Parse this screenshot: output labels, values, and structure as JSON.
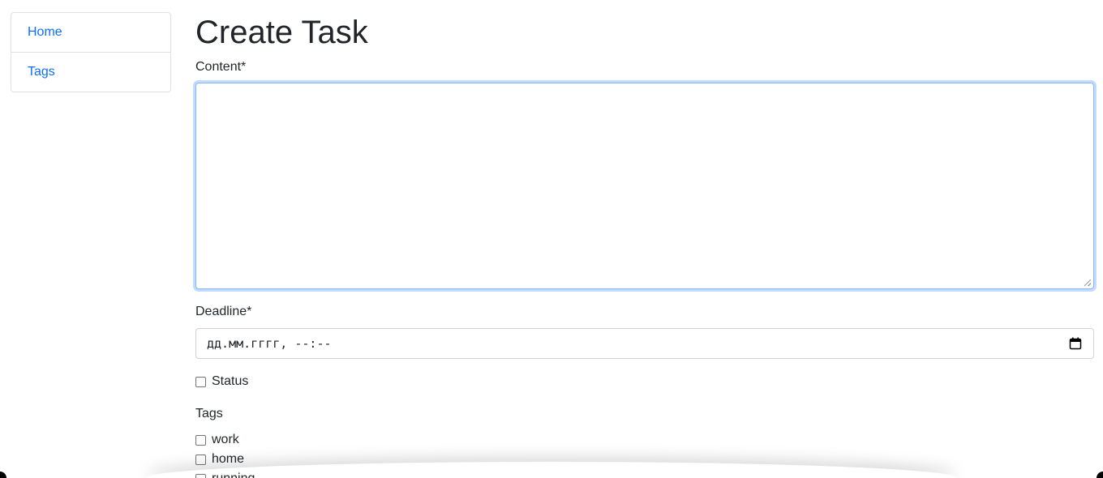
{
  "sidebar": {
    "items": [
      {
        "label": "Home"
      },
      {
        "label": "Tags"
      }
    ]
  },
  "main": {
    "title": "Create Task",
    "content_label": "Content*",
    "content_value": "",
    "deadline_label": "Deadline*",
    "deadline_placeholder": "дд.мм.гггг, --:--",
    "status_label": "Status",
    "tags_label": "Tags",
    "tags": [
      {
        "label": "work"
      },
      {
        "label": "home"
      },
      {
        "label": "running"
      }
    ]
  },
  "icons": {
    "calendar": "calendar-icon"
  },
  "colors": {
    "link": "#0d6efd",
    "focus_border": "#86b7fe",
    "text": "#212529",
    "border": "#dee2e6"
  }
}
